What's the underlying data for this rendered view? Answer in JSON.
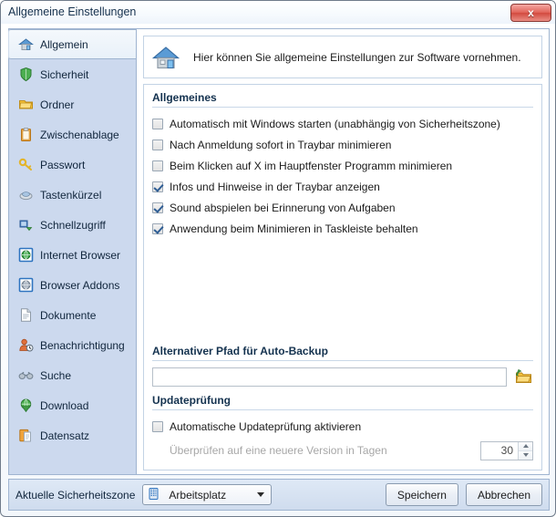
{
  "window": {
    "title": "Allgemeine Einstellungen",
    "close_label": "x",
    "close_icon": "close-icon"
  },
  "sidebar": {
    "items": [
      {
        "label": "Allgemein",
        "icon": "home-icon",
        "selected": true
      },
      {
        "label": "Sicherheit",
        "icon": "shield-icon",
        "selected": false
      },
      {
        "label": "Ordner",
        "icon": "folder-icon",
        "selected": false
      },
      {
        "label": "Zwischenablage",
        "icon": "clipboard-icon",
        "selected": false
      },
      {
        "label": "Passwort",
        "icon": "key-icon",
        "selected": false
      },
      {
        "label": "Tastenkürzel",
        "icon": "keyboard-icon",
        "selected": false
      },
      {
        "label": "Schnellzugriff",
        "icon": "quick-access-icon",
        "selected": false
      },
      {
        "label": "Internet Browser",
        "icon": "globe-window-icon",
        "selected": false
      },
      {
        "label": "Browser Addons",
        "icon": "addons-globe-icon",
        "selected": false
      },
      {
        "label": "Dokumente",
        "icon": "document-icon",
        "selected": false
      },
      {
        "label": "Benachrichtigung",
        "icon": "user-clock-icon",
        "selected": false
      },
      {
        "label": "Suche",
        "icon": "binoculars-icon",
        "selected": false
      },
      {
        "label": "Download",
        "icon": "download-icon",
        "selected": false
      },
      {
        "label": "Datensatz",
        "icon": "dataset-icon",
        "selected": false
      }
    ]
  },
  "banner": {
    "icon": "home-large-icon",
    "text": "Hier können Sie allgemeine Einstellungen zur Software vornehmen."
  },
  "general_group": {
    "title": "Allgemeines",
    "checkboxes": [
      {
        "label": "Automatisch mit Windows starten (unabhängig von Sicherheitszone)",
        "checked": false
      },
      {
        "label": "Nach Anmeldung sofort in Traybar minimieren",
        "checked": false
      },
      {
        "label": "Beim Klicken auf X im Hauptfenster Programm minimieren",
        "checked": false
      },
      {
        "label": "Infos und Hinweise in der Traybar anzeigen",
        "checked": true
      },
      {
        "label": "Sound abspielen bei Erinnerung von Aufgaben",
        "checked": true
      },
      {
        "label": "Anwendung beim Minimieren in Taskleiste behalten",
        "checked": true
      }
    ]
  },
  "backup_group": {
    "title": "Alternativer Pfad für Auto-Backup",
    "path_value": "",
    "path_placeholder": "",
    "browse_icon": "open-folder-icon"
  },
  "update_group": {
    "title": "Updateprüfung",
    "enable_checkbox": {
      "label": "Automatische Updateprüfung aktivieren",
      "checked": false
    },
    "interval_label": "Überprüfen auf eine neuere Version in Tagen",
    "interval_value": "30"
  },
  "bottom_bar": {
    "zone_label": "Aktuelle Sicherheitszone",
    "zone_value": "Arbeitsplatz",
    "zone_icon": "computer-icon",
    "save_label": "Speichern",
    "cancel_label": "Abbrechen"
  },
  "colors": {
    "sidebar_bg": "#ccd9ee",
    "panel_border": "#9fb4d0",
    "heading": "#14324f",
    "close_red": "#d24a3f",
    "check_blue": "#2e5d94"
  }
}
